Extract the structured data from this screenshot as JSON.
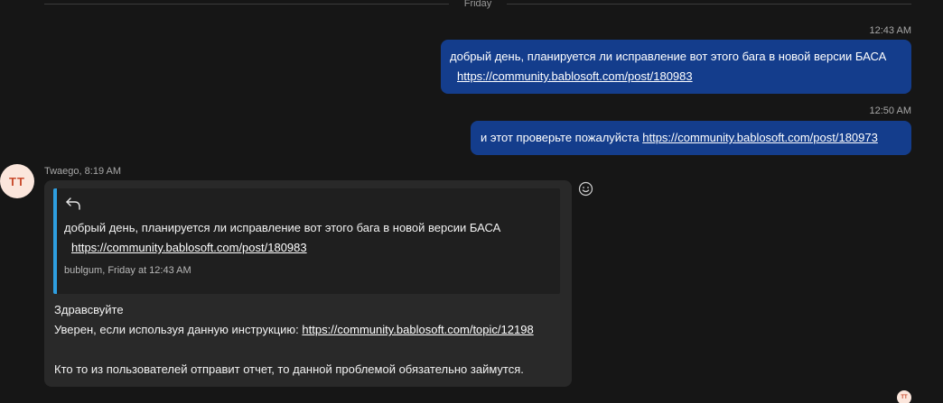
{
  "divider": {
    "label": "Friday"
  },
  "outgoing": [
    {
      "time": "12:43 AM",
      "text": "добрый день, планируется ли исправление вот этого бага в новой версии БАСА",
      "link": "https://community.bablosoft.com/post/180983"
    },
    {
      "time": "12:50 AM",
      "text": "и этот проверьте пожалуйста",
      "link": "https://community.bablosoft.com/post/180973"
    }
  ],
  "incoming": {
    "avatar_initials": "TT",
    "sender": "Twaego",
    "time": "8:19 AM",
    "quote": {
      "icon": "reply-arrow-icon",
      "text": "добрый день, планируется ли исправление вот этого бага в новой версии БАСА",
      "link": "https://community.bablosoft.com/post/180983",
      "author": "bublgum",
      "timestamp": "Friday at 12:43 AM"
    },
    "body": {
      "greeting": "Здравсвуйте",
      "line2_text": "Уверен, если используя данную инструкцию:",
      "line2_link": "https://community.bablosoft.com/topic/12198",
      "line3": "Кто то из пользователей отправит отчет, то данной проблемой обязательно займутся."
    }
  },
  "reactions": {
    "icon": "smiley-icon"
  },
  "read_receipt": {
    "initials": "TT"
  },
  "colors": {
    "background": "#161616",
    "outgoing_bubble": "#143d8c",
    "incoming_bubble": "#292929",
    "quote_accent": "#2e9ee0",
    "avatar_bg": "#fbe6dc",
    "avatar_text": "#c84a2c"
  }
}
